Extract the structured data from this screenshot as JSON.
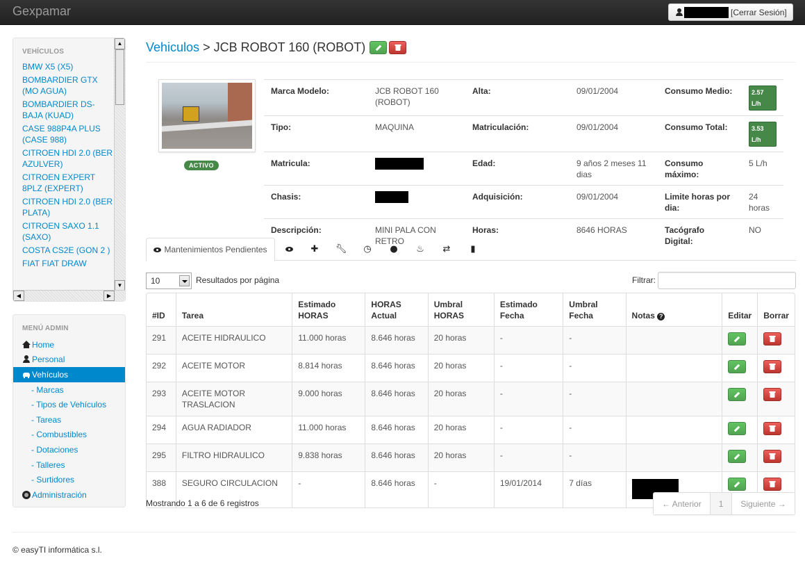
{
  "navbar": {
    "brand": "Gexpamar",
    "logout_label": "[Cerrar Sesión]"
  },
  "sidebar": {
    "vehicles_header": "VEHÍCULOS",
    "vehicles": [
      {
        "label": "BMW X5 (X5)"
      },
      {
        "label": "BOMBARDIER GTX (MO AGUA)"
      },
      {
        "label": "BOMBARDIER DS-BAJA (KUAD)"
      },
      {
        "label": "CASE 988P4A PLUS (CASE 988)"
      },
      {
        "label": "CITROEN HDI 2.0 (BER AZULVER)"
      },
      {
        "label": "CITROEN EXPERT 8PLZ (EXPERT)"
      },
      {
        "label": "CITROEN HDI 2.0 (BER PLATA)"
      },
      {
        "label": "CITROEN SAXO 1.1 (SAXO)"
      },
      {
        "label": "COSTA CS2E (GON 2 )"
      },
      {
        "label": "FIAT FIAT DRAW"
      }
    ],
    "admin_header": "MENÚ ADMIN",
    "admin": {
      "home": "Home",
      "personal": "Personal",
      "vehiculos": "Vehículos",
      "marcas": "- Marcas",
      "tipos": "- Tipos de Vehículos",
      "tareas": "- Tareas",
      "combustibles": "- Combustibles",
      "dotaciones": "- Dotaciones",
      "talleres": "- Talleres",
      "surtidores": "- Surtidores",
      "administracion": "Administración"
    }
  },
  "header": {
    "breadcrumb_root": "Vehiculos",
    "separator": ">",
    "title": "JCB ROBOT 160 (ROBOT)"
  },
  "vehicle": {
    "status": "ACTIVO",
    "details": {
      "marca_modelo_k": "Marca Modelo:",
      "marca_modelo_v": "JCB ROBOT 160 (ROBOT)",
      "alta_k": "Alta:",
      "alta_v": "09/01/2004",
      "consumo_medio_k": "Consumo Medio:",
      "consumo_medio_v": "2.57 L/h",
      "tipo_k": "Tipo:",
      "tipo_v": "MAQUINA",
      "matriculacion_k": "Matriculación:",
      "matriculacion_v": "09/01/2004",
      "consumo_total_k": "Consumo Total:",
      "consumo_total_v": "3.53 L/h",
      "matricula_k": "Matricula:",
      "edad_k": "Edad:",
      "edad_v": "9 años 2 meses 11 dias",
      "consumo_max_k": "Consumo máximo:",
      "consumo_max_v": "5 L/h",
      "chasis_k": "Chasis:",
      "adquisicion_k": "Adquisición:",
      "adquisicion_v": "09/01/2004",
      "limite_k": "Limite horas por dia:",
      "limite_v": "24 horas",
      "descripcion_k": "Descripción:",
      "descripcion_v": "MINI PALA CON RETRO",
      "horas_k": "Horas:",
      "horas_v": "8646 HORAS",
      "tacografo_k": "Tacógrafo Digital:",
      "tacografo_v": "NO"
    }
  },
  "tabs": {
    "active_label": "Mantenimientos Pendientes",
    "icons": [
      "eye-icon",
      "plus-icon",
      "wrench-icon",
      "clock-icon",
      "tint-icon",
      "fire-icon",
      "retweet-icon",
      "file-icon"
    ]
  },
  "table_controls": {
    "page_size": "10",
    "page_size_label": "Resultados por página",
    "filter_label": "Filtrar:"
  },
  "maintenance": {
    "headers": {
      "id": "#ID",
      "tarea": "Tarea",
      "estimado_horas": "Estimado HORAS",
      "horas_actual": "HORAS Actual",
      "umbral_horas": "Umbral HORAS",
      "estimado_fecha": "Estimado Fecha",
      "umbral_fecha": "Umbral Fecha",
      "notas": "Notas",
      "editar": "Editar",
      "borrar": "Borrar"
    },
    "rows": [
      {
        "id": "291",
        "tarea": "ACEITE HIDRAULICO",
        "estimado_horas": "11.000 horas",
        "horas_actual": "8.646 horas",
        "umbral_horas": "20 horas",
        "estimado_fecha": "-",
        "umbral_fecha": "-",
        "notas": ""
      },
      {
        "id": "292",
        "tarea": "ACEITE MOTOR",
        "estimado_horas": "8.814 horas",
        "horas_actual": "8.646 horas",
        "umbral_horas": "20 horas",
        "estimado_fecha": "-",
        "umbral_fecha": "-",
        "notas": ""
      },
      {
        "id": "293",
        "tarea": "ACEITE MOTOR TRASLACION",
        "estimado_horas": "9.000 horas",
        "horas_actual": "8.646 horas",
        "umbral_horas": "20 horas",
        "estimado_fecha": "-",
        "umbral_fecha": "-",
        "notas": ""
      },
      {
        "id": "294",
        "tarea": "AGUA RADIADOR",
        "estimado_horas": "11.000 horas",
        "horas_actual": "8.646 horas",
        "umbral_horas": "20 horas",
        "estimado_fecha": "-",
        "umbral_fecha": "-",
        "notas": ""
      },
      {
        "id": "295",
        "tarea": "FILTRO HIDRAULICO",
        "estimado_horas": "9.838 horas",
        "horas_actual": "8.646 horas",
        "umbral_horas": "20 horas",
        "estimado_fecha": "-",
        "umbral_fecha": "-",
        "notas": ""
      },
      {
        "id": "388",
        "tarea": "SEGURO CIRCULACION",
        "estimado_horas": "-",
        "horas_actual": "8.646 horas",
        "umbral_horas": "-",
        "estimado_fecha": "19/01/2014",
        "umbral_fecha": "7 días",
        "notas": "redacted"
      }
    ]
  },
  "footer": {
    "info": "Mostrando 1 a 6 de 6 registros",
    "prev": "← Anterior",
    "page": "1",
    "next": "Siguiente →",
    "copyright": "© easyTI informática s.l."
  },
  "colors": {
    "link": "#0088cc",
    "success": "#51a351",
    "danger": "#bd362f",
    "navbar": "#222222"
  }
}
